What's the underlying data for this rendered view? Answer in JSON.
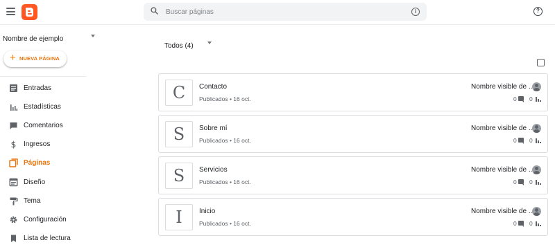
{
  "app": {
    "icon": "blogger-logo",
    "brand_color": "#ff5722",
    "accent": "#e8710a"
  },
  "search": {
    "placeholder": "Buscar páginas"
  },
  "sidebar": {
    "blog_name": "Nombre de ejemplo",
    "new_page_label": "NUEVA PÁGINA",
    "items": [
      {
        "label": "Entradas",
        "icon": "posts-icon"
      },
      {
        "label": "Estadísticas",
        "icon": "stats-icon"
      },
      {
        "label": "Comentarios",
        "icon": "comments-icon"
      },
      {
        "label": "Ingresos",
        "icon": "dollar-icon"
      },
      {
        "label": "Páginas",
        "icon": "pages-icon",
        "active": true
      },
      {
        "label": "Diseño",
        "icon": "layout-icon"
      },
      {
        "label": "Tema",
        "icon": "theme-icon"
      },
      {
        "label": "Configuración",
        "icon": "gear-icon"
      },
      {
        "label": "Lista de lectura",
        "icon": "bookmark-icon"
      }
    ]
  },
  "main": {
    "filter_label": "Todos (4)",
    "pages": [
      {
        "letter": "C",
        "title": "Contacto",
        "meta": "Publicados • 16 oct.",
        "author": "Nombre visible de ...",
        "comments": "0",
        "views": "0"
      },
      {
        "letter": "S",
        "title": "Sobre mí",
        "meta": "Publicados • 16 oct.",
        "author": "Nombre visible de ...",
        "comments": "0",
        "views": "0"
      },
      {
        "letter": "S",
        "title": "Servicios",
        "meta": "Publicados • 16 oct.",
        "author": "Nombre visible de ...",
        "comments": "0",
        "views": "0"
      },
      {
        "letter": "I",
        "title": "Inicio",
        "meta": "Publicados • 16 oct.",
        "author": "Nombre visible de ...",
        "comments": "0",
        "views": "0"
      }
    ]
  }
}
